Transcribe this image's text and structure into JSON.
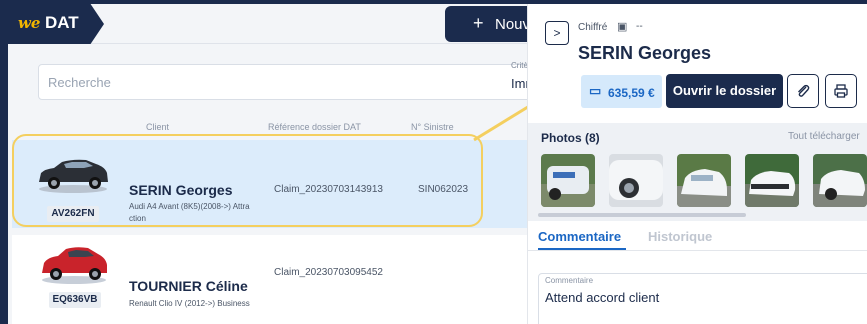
{
  "header": {
    "logo_prefix": "we",
    "logo_brand": "DAT",
    "new_button_label": "Nouve"
  },
  "search": {
    "placeholder": "Recherche",
    "criteria_label": "Critè",
    "criteria_value": "Imm"
  },
  "columns": [
    "Client",
    "Référence dossier DAT",
    "N° Sinistre"
  ],
  "rows": [
    {
      "plate": "AV262FN",
      "client": "SERIN Georges",
      "model_line1": "Audi A4 Avant (8K5)(2008->) Attra",
      "model_line2": "ction",
      "reference": "Claim_20230703143913",
      "claim_number": "SIN062023",
      "car_color": "#2b2f36",
      "selected": true
    },
    {
      "plate": "EQ636VB",
      "client": "TOURNIER Céline",
      "model_line1": "Renault Clio IV (2012->) Business",
      "model_line2": "",
      "reference": "Claim_20230703095452",
      "claim_number": "",
      "car_color": "#c9232b",
      "selected": false
    }
  ],
  "panel": {
    "status": "Chiffré",
    "date_placeholder": "--",
    "client_name": "SERIN Georges",
    "amount": "635,59 €",
    "open_button_label": "Ouvrir le dossier",
    "photos_title": "Photos (8)",
    "download_all_label": "Tout télécharger",
    "tabs": [
      "Commentaire",
      "Historique"
    ],
    "comment_label": "Commentaire",
    "comment_value": "Attend accord client"
  },
  "colors": {
    "brand_dark": "#1b2b4d",
    "accent_blue": "#1b67c4",
    "highlight_yellow": "#f4cf5f",
    "logo_yellow": "#f2b600"
  },
  "icons": [
    "plus-icon",
    "chevron-right-icon",
    "calendar-icon",
    "wallet-icon",
    "paperclip-icon",
    "printer-icon",
    "arrow-icon"
  ]
}
